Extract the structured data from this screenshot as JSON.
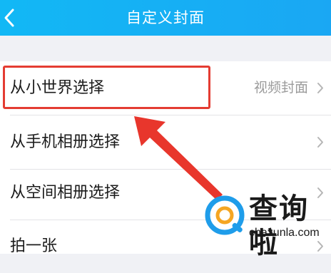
{
  "header": {
    "title": "自定义封面",
    "back_icon": "chevron-left-icon",
    "background": "#15b2f4"
  },
  "list": {
    "items": [
      {
        "label": "从小世界选择",
        "value": "视频封面"
      },
      {
        "label": "从手机相册选择"
      },
      {
        "label": "从空间相册选择"
      },
      {
        "label": "拍一张"
      }
    ]
  },
  "annotation": {
    "highlight_color": "#e43c32",
    "arrow_icon": "arrow-pointer-icon"
  },
  "watermark": {
    "brand": "查询啦",
    "url": "chaxunla.com",
    "logo_icon": "magnifier-q-icon"
  }
}
